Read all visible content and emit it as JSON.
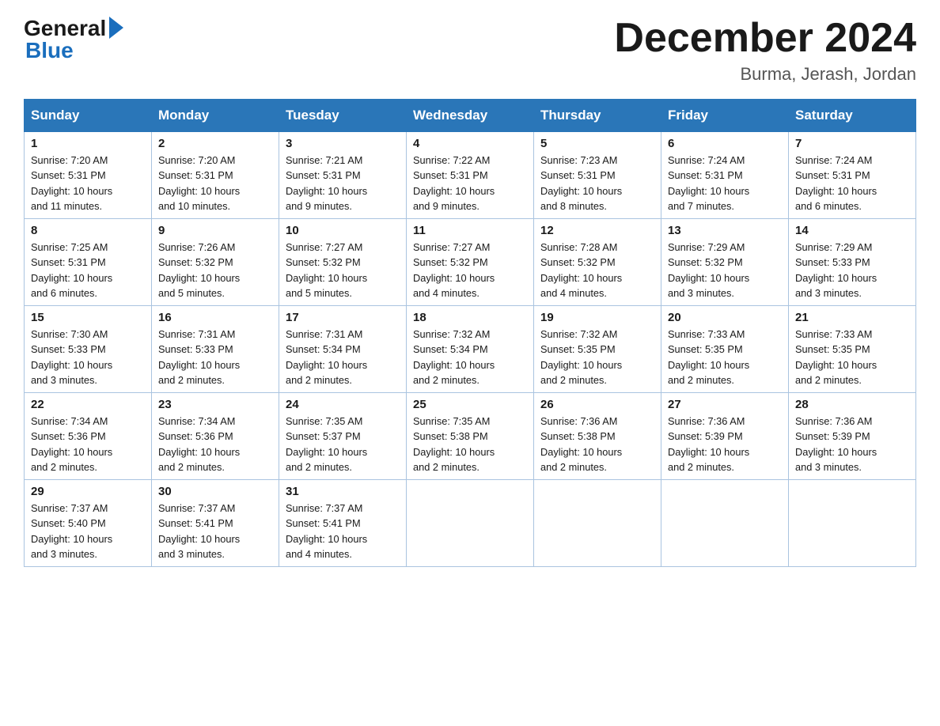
{
  "logo": {
    "general": "General",
    "blue": "Blue"
  },
  "title": {
    "month": "December 2024",
    "location": "Burma, Jerash, Jordan"
  },
  "headers": [
    "Sunday",
    "Monday",
    "Tuesday",
    "Wednesday",
    "Thursday",
    "Friday",
    "Saturday"
  ],
  "weeks": [
    [
      {
        "day": "1",
        "sunrise": "7:20 AM",
        "sunset": "5:31 PM",
        "daylight": "10 hours and 11 minutes."
      },
      {
        "day": "2",
        "sunrise": "7:20 AM",
        "sunset": "5:31 PM",
        "daylight": "10 hours and 10 minutes."
      },
      {
        "day": "3",
        "sunrise": "7:21 AM",
        "sunset": "5:31 PM",
        "daylight": "10 hours and 9 minutes."
      },
      {
        "day": "4",
        "sunrise": "7:22 AM",
        "sunset": "5:31 PM",
        "daylight": "10 hours and 9 minutes."
      },
      {
        "day": "5",
        "sunrise": "7:23 AM",
        "sunset": "5:31 PM",
        "daylight": "10 hours and 8 minutes."
      },
      {
        "day": "6",
        "sunrise": "7:24 AM",
        "sunset": "5:31 PM",
        "daylight": "10 hours and 7 minutes."
      },
      {
        "day": "7",
        "sunrise": "7:24 AM",
        "sunset": "5:31 PM",
        "daylight": "10 hours and 6 minutes."
      }
    ],
    [
      {
        "day": "8",
        "sunrise": "7:25 AM",
        "sunset": "5:31 PM",
        "daylight": "10 hours and 6 minutes."
      },
      {
        "day": "9",
        "sunrise": "7:26 AM",
        "sunset": "5:32 PM",
        "daylight": "10 hours and 5 minutes."
      },
      {
        "day": "10",
        "sunrise": "7:27 AM",
        "sunset": "5:32 PM",
        "daylight": "10 hours and 5 minutes."
      },
      {
        "day": "11",
        "sunrise": "7:27 AM",
        "sunset": "5:32 PM",
        "daylight": "10 hours and 4 minutes."
      },
      {
        "day": "12",
        "sunrise": "7:28 AM",
        "sunset": "5:32 PM",
        "daylight": "10 hours and 4 minutes."
      },
      {
        "day": "13",
        "sunrise": "7:29 AM",
        "sunset": "5:32 PM",
        "daylight": "10 hours and 3 minutes."
      },
      {
        "day": "14",
        "sunrise": "7:29 AM",
        "sunset": "5:33 PM",
        "daylight": "10 hours and 3 minutes."
      }
    ],
    [
      {
        "day": "15",
        "sunrise": "7:30 AM",
        "sunset": "5:33 PM",
        "daylight": "10 hours and 3 minutes."
      },
      {
        "day": "16",
        "sunrise": "7:31 AM",
        "sunset": "5:33 PM",
        "daylight": "10 hours and 2 minutes."
      },
      {
        "day": "17",
        "sunrise": "7:31 AM",
        "sunset": "5:34 PM",
        "daylight": "10 hours and 2 minutes."
      },
      {
        "day": "18",
        "sunrise": "7:32 AM",
        "sunset": "5:34 PM",
        "daylight": "10 hours and 2 minutes."
      },
      {
        "day": "19",
        "sunrise": "7:32 AM",
        "sunset": "5:35 PM",
        "daylight": "10 hours and 2 minutes."
      },
      {
        "day": "20",
        "sunrise": "7:33 AM",
        "sunset": "5:35 PM",
        "daylight": "10 hours and 2 minutes."
      },
      {
        "day": "21",
        "sunrise": "7:33 AM",
        "sunset": "5:35 PM",
        "daylight": "10 hours and 2 minutes."
      }
    ],
    [
      {
        "day": "22",
        "sunrise": "7:34 AM",
        "sunset": "5:36 PM",
        "daylight": "10 hours and 2 minutes."
      },
      {
        "day": "23",
        "sunrise": "7:34 AM",
        "sunset": "5:36 PM",
        "daylight": "10 hours and 2 minutes."
      },
      {
        "day": "24",
        "sunrise": "7:35 AM",
        "sunset": "5:37 PM",
        "daylight": "10 hours and 2 minutes."
      },
      {
        "day": "25",
        "sunrise": "7:35 AM",
        "sunset": "5:38 PM",
        "daylight": "10 hours and 2 minutes."
      },
      {
        "day": "26",
        "sunrise": "7:36 AM",
        "sunset": "5:38 PM",
        "daylight": "10 hours and 2 minutes."
      },
      {
        "day": "27",
        "sunrise": "7:36 AM",
        "sunset": "5:39 PM",
        "daylight": "10 hours and 2 minutes."
      },
      {
        "day": "28",
        "sunrise": "7:36 AM",
        "sunset": "5:39 PM",
        "daylight": "10 hours and 3 minutes."
      }
    ],
    [
      {
        "day": "29",
        "sunrise": "7:37 AM",
        "sunset": "5:40 PM",
        "daylight": "10 hours and 3 minutes."
      },
      {
        "day": "30",
        "sunrise": "7:37 AM",
        "sunset": "5:41 PM",
        "daylight": "10 hours and 3 minutes."
      },
      {
        "day": "31",
        "sunrise": "7:37 AM",
        "sunset": "5:41 PM",
        "daylight": "10 hours and 4 minutes."
      },
      null,
      null,
      null,
      null
    ]
  ],
  "labels": {
    "sunrise": "Sunrise:",
    "sunset": "Sunset:",
    "daylight": "Daylight:"
  }
}
